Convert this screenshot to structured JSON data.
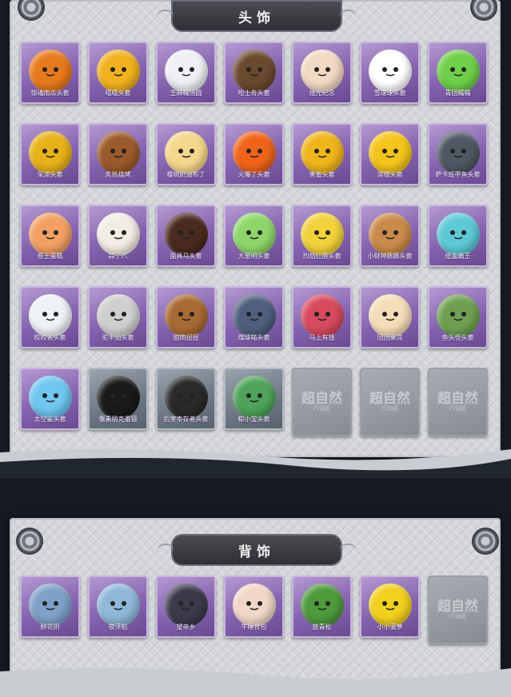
{
  "sections": [
    {
      "title": "头饰",
      "items": [
        {
          "name": "惊魂南瓜头套",
          "icon": "pumpkin-icon",
          "color": "#e87a1e"
        },
        {
          "name": "嘻嘻头套",
          "icon": "grin-face-icon",
          "color": "#f2b21f"
        },
        {
          "name": "芝麻糯汤圆",
          "icon": "dumpling-icon",
          "color": "#eef0f4"
        },
        {
          "name": "哈士奇头套",
          "icon": "husky-icon",
          "color": "#6a4a2e"
        },
        {
          "name": "烛光纪念",
          "icon": "candle-icon",
          "color": "#f1d9c4"
        },
        {
          "name": "雪球球头套",
          "icon": "snowman-icon",
          "color": "#ffffff"
        },
        {
          "name": "青团糯糯",
          "icon": "green-dumpling-icon",
          "color": "#6fcf4a"
        },
        {
          "name": "呆滞头套",
          "icon": "dazed-face-icon",
          "color": "#e8b21a"
        },
        {
          "name": "炙热烧烤",
          "icon": "grilled-meat-icon",
          "color": "#9b5a2b"
        },
        {
          "name": "樱桃奶油布丁",
          "icon": "pudding-icon",
          "color": "#f5d78c"
        },
        {
          "name": "火爆了头套",
          "icon": "flame-icon",
          "color": "#f0641a"
        },
        {
          "name": "害羞头套",
          "icon": "shy-face-icon",
          "color": "#f0b51c"
        },
        {
          "name": "滑稽头套",
          "icon": "funny-face-icon",
          "color": "#f4c51c"
        },
        {
          "name": "萨卡班甲鱼头套",
          "icon": "fish-icon",
          "color": "#4f5863"
        },
        {
          "name": "卷王蛋糕",
          "icon": "cake-roll-icon",
          "color": "#f3a064"
        },
        {
          "name": "蒜了八",
          "icon": "garlic-icon",
          "color": "#f2ede2"
        },
        {
          "name": "面具马头套",
          "icon": "horse-icon",
          "color": "#4a2a1e"
        },
        {
          "name": "大葱明头套",
          "icon": "scallion-icon",
          "color": "#8fd66a"
        },
        {
          "name": "烈焰红唇头套",
          "icon": "pikachu-icon",
          "color": "#f2d23a"
        },
        {
          "name": "小财神豚豚头套",
          "icon": "capybara-icon",
          "color": "#c98a4a"
        },
        {
          "name": "纸盒霸王",
          "icon": "box-dino-icon",
          "color": "#5ec9d6"
        },
        {
          "name": "皎皎者头套",
          "icon": "cloud-icon",
          "color": "#eef1f5"
        },
        {
          "name": "驼半仙头套",
          "icon": "raccoon-icon",
          "color": "#cfcfcf"
        },
        {
          "name": "甜筒扭扭",
          "icon": "dog-icon",
          "color": "#a86a34"
        },
        {
          "name": "煤球喵头套",
          "icon": "cat-icon",
          "color": "#4f5f7e"
        },
        {
          "name": "马上有钱",
          "icon": "red-horse-icon",
          "color": "#d84a5e"
        },
        {
          "name": "团团乘凉",
          "icon": "cream-bun-icon",
          "color": "#f4ddb8"
        },
        {
          "name": "鱼头怪头套",
          "icon": "fish-head-icon",
          "color": "#6fa052"
        },
        {
          "name": "太空鲨头套",
          "icon": "shark-icon",
          "color": "#6fc7ef",
          "gray": false
        },
        {
          "name": "像素朋克墨镜",
          "icon": "pixel-glasses-icon",
          "color": "#1a1a1a",
          "gray": true
        },
        {
          "name": "后室幸存者头套",
          "icon": "gas-mask-icon",
          "color": "#2a2a2a",
          "gray": true
        },
        {
          "name": "粽小宝头套",
          "icon": "zongzi-icon",
          "color": "#4fa35a",
          "gray": true
        },
        {
          "name": "",
          "empty": true
        },
        {
          "name": "",
          "empty": true
        },
        {
          "name": "",
          "empty": true
        }
      ]
    },
    {
      "title": "背饰",
      "items": [
        {
          "name": "醉花阴",
          "icon": "flower-ornament-icon",
          "color": "#7fa0c8"
        },
        {
          "name": "夜浮船",
          "icon": "crystal-boat-icon",
          "color": "#8fb8d8"
        },
        {
          "name": "望帝乡",
          "icon": "doll-figure-icon",
          "color": "#3a3a4a"
        },
        {
          "name": "牛睡背包",
          "icon": "cow-backpack-icon",
          "color": "#f0d7c8"
        },
        {
          "name": "放青松",
          "icon": "bonsai-icon",
          "color": "#4f9a3c"
        },
        {
          "name": "小小菠萝",
          "icon": "pineapple-icon",
          "color": "#f2d01e"
        },
        {
          "name": "",
          "empty": true
        }
      ]
    }
  ],
  "watermark": {
    "main": "超自然",
    "sub": "行动组"
  }
}
